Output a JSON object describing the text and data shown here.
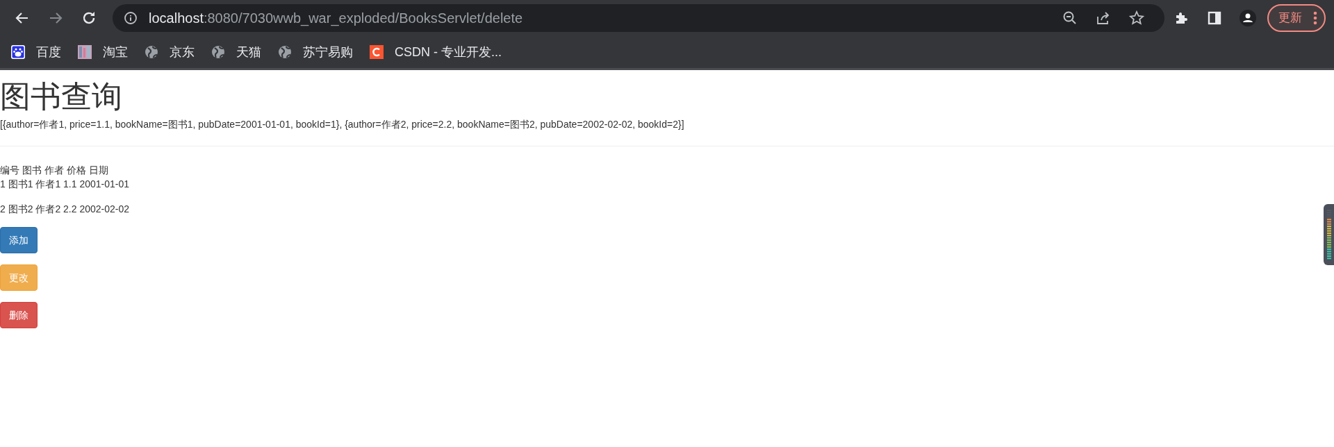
{
  "browser": {
    "address": {
      "host": "localhost",
      "path": ":8080/7030wwb_war_exploded/BooksServlet/delete"
    },
    "update_button": "更新"
  },
  "bookmarks": [
    {
      "label": "百度",
      "kind": "baidu"
    },
    {
      "label": "淘宝",
      "kind": "taobao"
    },
    {
      "label": "京东",
      "kind": "globe"
    },
    {
      "label": "天猫",
      "kind": "globe"
    },
    {
      "label": "苏宁易购",
      "kind": "globe"
    },
    {
      "label": "CSDN - 专业开发...",
      "kind": "csdn"
    }
  ],
  "page": {
    "title": "图书查询",
    "raw_data": "[{author=作者1, price=1.1, bookName=图书1, pubDate=2001-01-01, bookId=1}, {author=作者2, price=2.2, bookName=图书2, pubDate=2002-02-02, bookId=2}]",
    "table": {
      "columns": [
        "编号",
        "图书",
        "作者",
        "价格",
        "日期"
      ],
      "rows": [
        [
          "1",
          "图书1",
          "作者1",
          "1.1",
          "2001-01-01"
        ],
        [
          "2",
          "图书2",
          "作者2",
          "2.2",
          "2002-02-02"
        ]
      ]
    },
    "buttons": [
      {
        "label": "添加",
        "kind": "primary"
      },
      {
        "label": "更改",
        "kind": "warning"
      },
      {
        "label": "删除",
        "kind": "danger"
      }
    ]
  }
}
